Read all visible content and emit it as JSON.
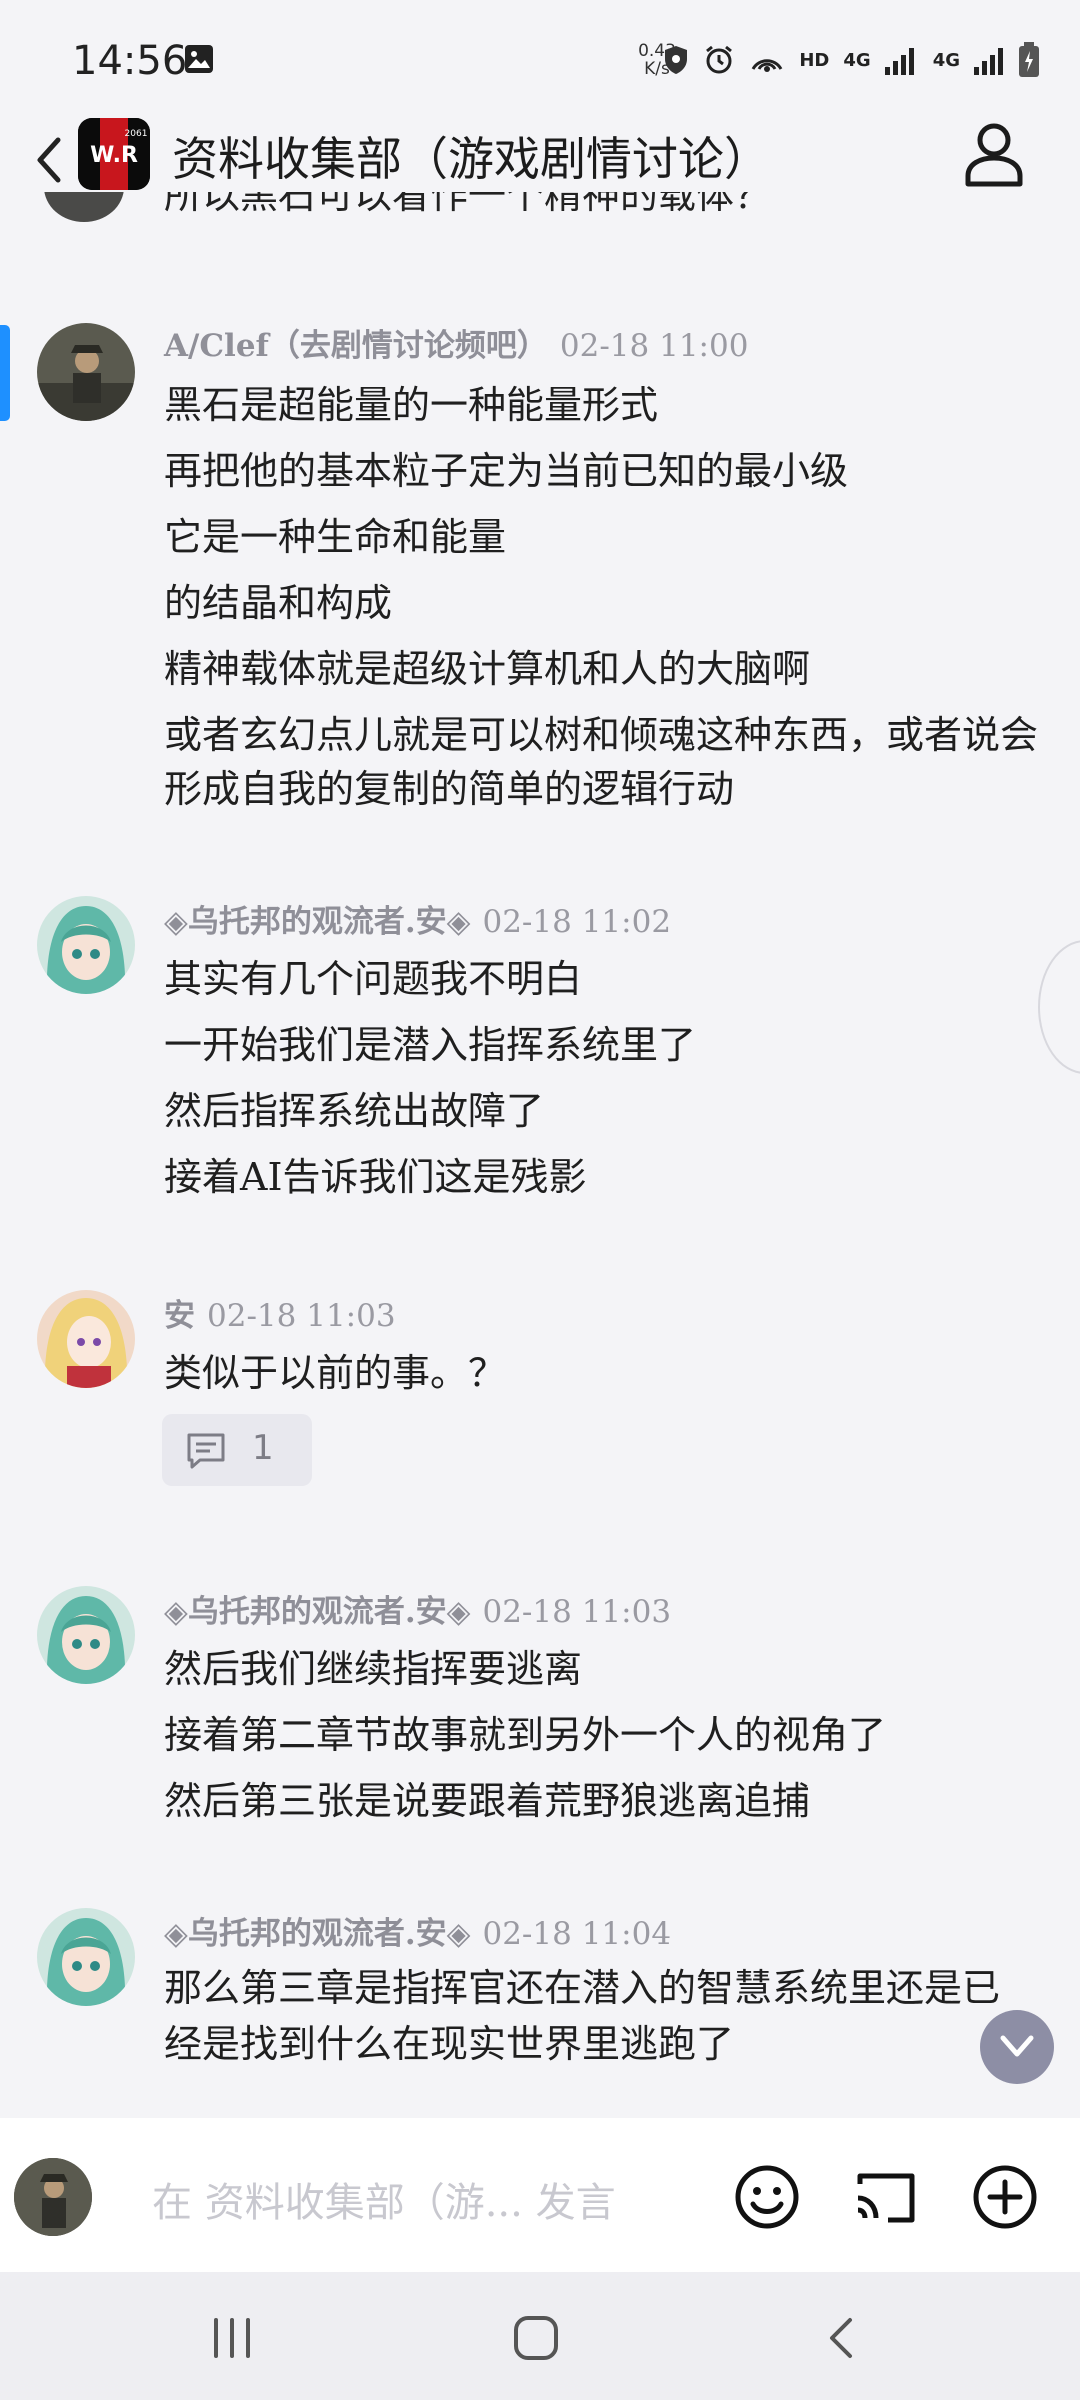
{
  "status_bar": {
    "time": "14:56",
    "net_speed_value": "0.43",
    "net_speed_unit": "K/s",
    "hd_label": "HD",
    "net_1": "4G",
    "net_2": "4G"
  },
  "header": {
    "title": "资料收集部（游戏剧情讨论）",
    "group_logo_text": "W.R",
    "group_logo_year": "2061"
  },
  "partial_message": "所以黑石可以看作一个精神的载体？",
  "messages": [
    {
      "name": "A/Clef（去剧情讨论频吧）",
      "time": "02-18 11:00",
      "lines": [
        "黑石是超能量的一种能量形式",
        "再把他的基本粒子定为当前已知的最小级",
        "它是一种生命和能量",
        "的结晶和构成",
        "精神载体就是超级计算机和人的大脑啊",
        "或者玄幻点儿就是可以树和倾魂这种东西，或者说会形成自我的复制的简单的逻辑行动"
      ]
    },
    {
      "name": "◈乌托邦的观流者.安◈",
      "time": "02-18 11:02",
      "lines": [
        "其实有几个问题我不明白",
        "一开始我们是潜入指挥系统里了",
        "然后指挥系统出故障了",
        "接着AI告诉我们这是残影"
      ]
    },
    {
      "name": "安",
      "time": "02-18 11:03",
      "lines": [
        "类似于以前的事。？"
      ],
      "reply_count": "1"
    },
    {
      "name": "◈乌托邦的观流者.安◈",
      "time": "02-18 11:03",
      "lines": [
        "然后我们继续指挥要逃离",
        "接着第二章节故事就到另外一个人的视角了",
        "然后第三张是说要跟着荒野狼逃离追捕"
      ]
    },
    {
      "name": "◈乌托邦的观流者.安◈",
      "time": "02-18 11:04",
      "lines": [
        "那么第三章是指挥官还在潜入的智慧系统里还是已经是找到什么在现实世界里逃跑了"
      ]
    }
  ],
  "input": {
    "placeholder": "在 资料收集部（游... 发言"
  },
  "colors": {
    "accent": "#1e90ff",
    "background": "#f4f4f7",
    "meta_text": "#8c8c96",
    "scroll_button": "#8d8ea5"
  }
}
